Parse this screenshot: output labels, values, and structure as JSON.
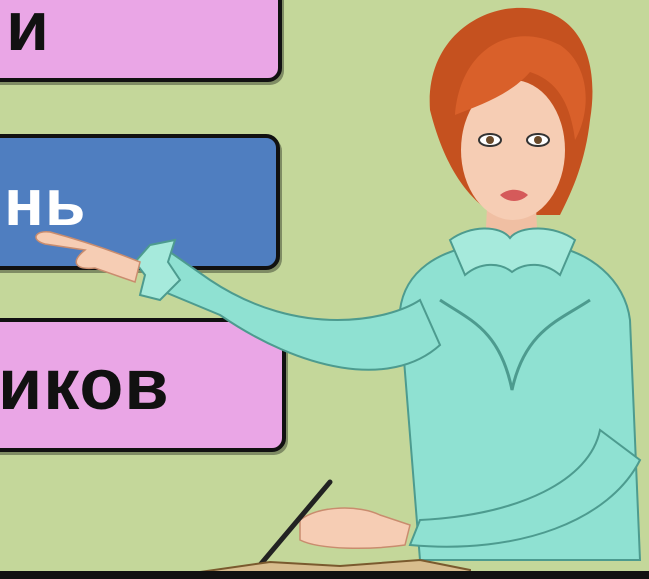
{
  "slide": {
    "background": "#c4d79a",
    "labels": [
      {
        "text": "и",
        "color": "#eaa6e6"
      },
      {
        "text": "нь",
        "color": "#4f7ec0"
      },
      {
        "text": "иков",
        "color": "#eaa6e6"
      }
    ]
  },
  "illustration": {
    "subject": "teacher-pointing-illustration",
    "palette": {
      "hair": "#d9602a",
      "blouse": "#8fe1d2",
      "skin": "#f6cdb4"
    }
  }
}
